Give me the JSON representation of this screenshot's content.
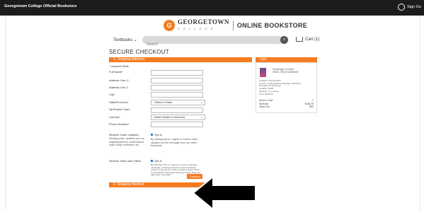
{
  "topbar": {
    "title": "Georgetown College Official Bookstore",
    "signout": "Sign Ou"
  },
  "logo": {
    "brand": "GEORGETOWN",
    "brand_sub": "C O L L E G E",
    "store": "ONLINE BOOKSTORE",
    "seal": "G"
  },
  "nav": {
    "textbooks": "Textbooks",
    "search_placeholder": "Search",
    "cart": "Cart (1)"
  },
  "page_title": "SECURE CHECKOUT",
  "shipping": {
    "header": "1. Shipping Address",
    "required_note": "* required fields",
    "labels": [
      "Full Name*",
      "Address Line 1*",
      "Address Line 2",
      "City*",
      "State/Province*",
      "Zip/Postal Code*",
      "Country*",
      "Phone Number*"
    ],
    "state_placeholder": "-Select a State-",
    "country_value": "United States of America",
    "receive_updates_label": "Receive Order Updates",
    "updates_desc": "Sending order updates such as shipping/delivery confirmations, order-ready reminders, etc.",
    "opt_in": "Opt-in",
    "updates_consent": "By clicking opt-in, I agree to receive order updates via text message from my online bookstore",
    "second_label": "Receive Sales and Offers",
    "offers_consent": "By selecting \"Opt-in\" I agree to receive marketing messages, including discounts and promotional events, at the phone number provided. Reply STOP to unsubscribe. Message frequency varies. Msg and data rates may apply.",
    "continue": "Continue"
  },
  "section2": {
    "header": "2. Shipping Method"
  },
  "cart": {
    "header": "Cart",
    "item_title": "Sociology In Action",
    "item_isbn": "ISBN: 9781071806289",
    "details": [
      {
        "k": "Condition:",
        "v": "Rental 2023"
      },
      {
        "k": "Course:",
        "v": "Understanding Sociology SOC111 A"
      },
      {
        "k": "",
        "v": "Principles Of Sociology"
      },
      {
        "k": "Location:",
        "v": "NWB"
      },
      {
        "k": "Quantity:",
        "v": "1 (remove)"
      },
      {
        "k": "Price:",
        "v": "$145.25"
      }
    ],
    "summary": [
      {
        "k": "Items in Cart:",
        "v": "1"
      },
      {
        "k": "Subtotal:",
        "v": "$145.25"
      },
      {
        "k": "Sales Tax:",
        "v": "TBD"
      }
    ]
  }
}
